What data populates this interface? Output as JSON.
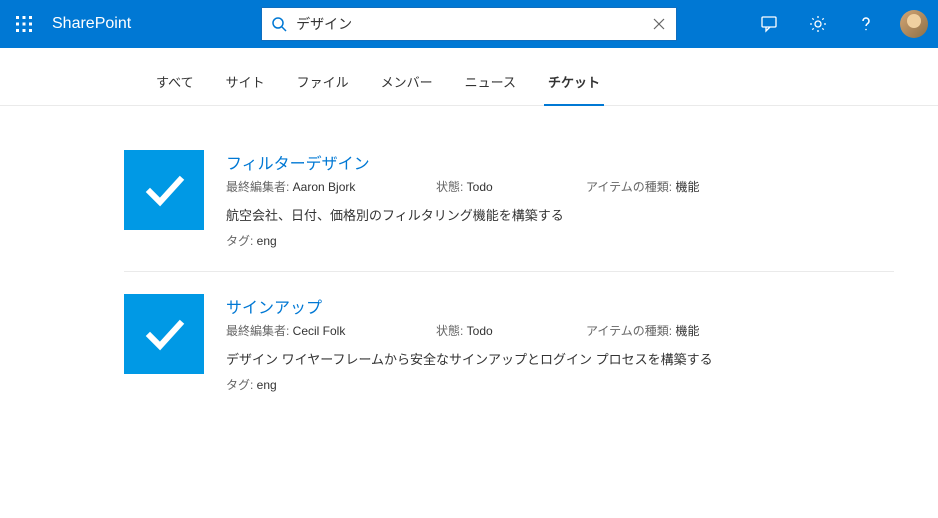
{
  "app": {
    "title": "SharePoint"
  },
  "search": {
    "value": "デザイン"
  },
  "tabs": [
    {
      "label": "すべて",
      "active": false
    },
    {
      "label": "サイト",
      "active": false
    },
    {
      "label": "ファイル",
      "active": false
    },
    {
      "label": "メンバー",
      "active": false
    },
    {
      "label": "ニュース",
      "active": false
    },
    {
      "label": "チケット",
      "active": true
    }
  ],
  "labels": {
    "editor": "最終編集者: ",
    "state": "状態: ",
    "itemtype": "アイテムの種類: ",
    "tags": "タグ: "
  },
  "results": [
    {
      "title": "フィルターデザイン",
      "editor": "Aaron Bjork",
      "state": "Todo",
      "itemtype": "機能",
      "description": "航空会社、日付、価格別のフィルタリング機能を構築する",
      "tags": "eng"
    },
    {
      "title": "サインアップ",
      "editor": "Cecil Folk",
      "state": "Todo",
      "itemtype": "機能",
      "description": "デザイン ワイヤーフレームから安全なサインアップとログイン プロセスを構築する",
      "tags": "eng"
    }
  ]
}
